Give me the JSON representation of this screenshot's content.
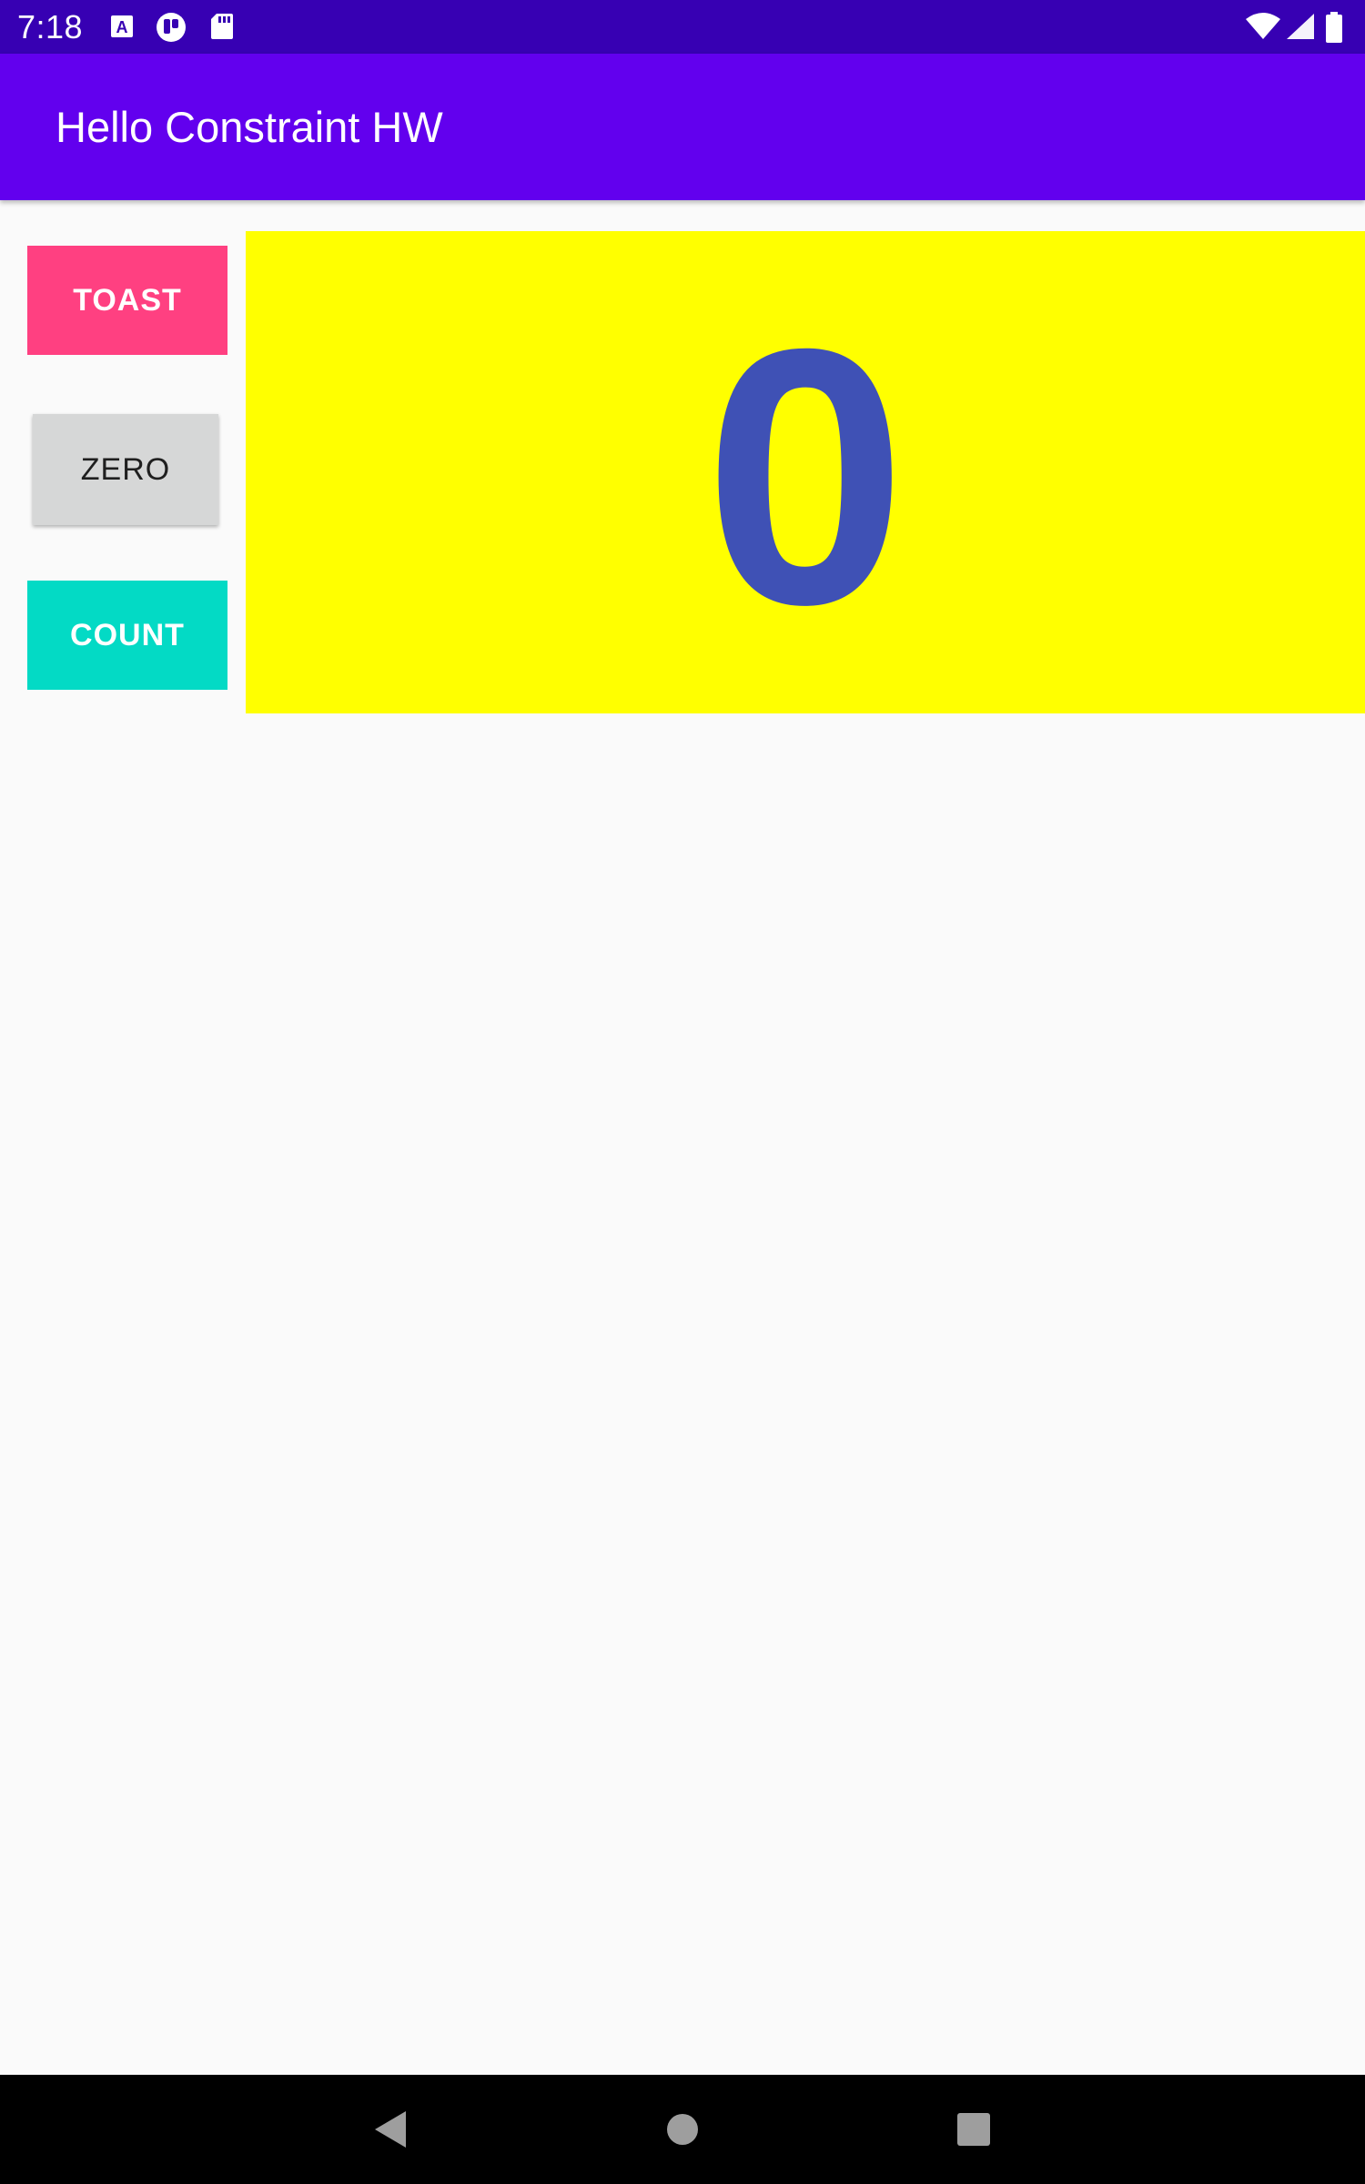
{
  "status_bar": {
    "time": "7:18",
    "left_icons": [
      "text-a-icon",
      "app-notification-icon",
      "sd-card-icon"
    ],
    "right_icons": [
      "wifi-icon",
      "cell-signal-icon",
      "battery-icon"
    ]
  },
  "app_bar": {
    "title": "Hello Constraint HW"
  },
  "buttons": {
    "toast_label": "TOAST",
    "zero_label": "ZERO",
    "count_label": "COUNT"
  },
  "counter": {
    "value": "0"
  },
  "nav_bar": {
    "icons": [
      "back-icon",
      "home-icon",
      "recents-icon"
    ]
  },
  "colors": {
    "status_bar": "#3700b3",
    "app_bar": "#6200ee",
    "toast_button": "#ff4081",
    "zero_button": "#d6d7d7",
    "count_button": "#03dac5",
    "count_panel": "#ffff00",
    "count_text": "#3f51b5"
  }
}
